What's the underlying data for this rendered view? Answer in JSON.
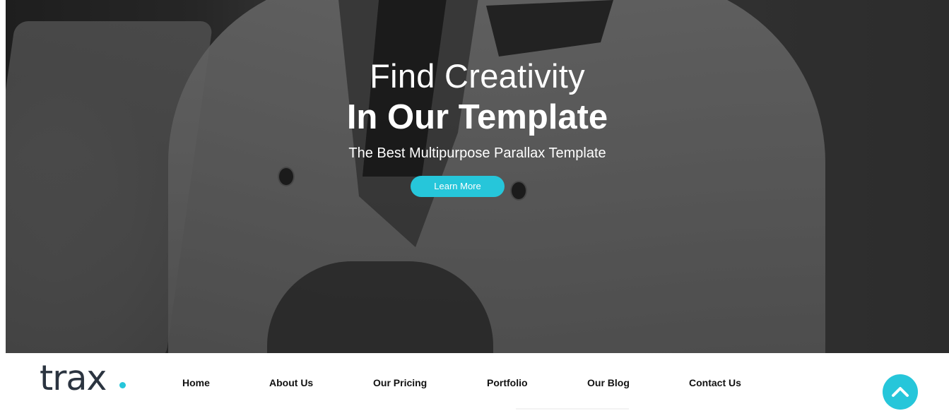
{
  "hero": {
    "title_line1": "Find Creativity",
    "title_line2": "In Our Template",
    "subtitle": "The Best Multipurpose Parallax Template",
    "cta_label": "Learn More"
  },
  "navbar": {
    "logo_text": "trax",
    "items": [
      {
        "label": "Home"
      },
      {
        "label": "About Us"
      },
      {
        "label": "Our Pricing"
      },
      {
        "label": "Portfolio"
      },
      {
        "label": "Our Blog"
      },
      {
        "label": "Contact Us"
      }
    ]
  },
  "scroll_top": {
    "icon": "chevron-up-icon"
  },
  "colors": {
    "accent": "#26c6da",
    "logo_text": "#2b3440",
    "nav_text": "#111111",
    "hero_text": "#ffffff"
  }
}
